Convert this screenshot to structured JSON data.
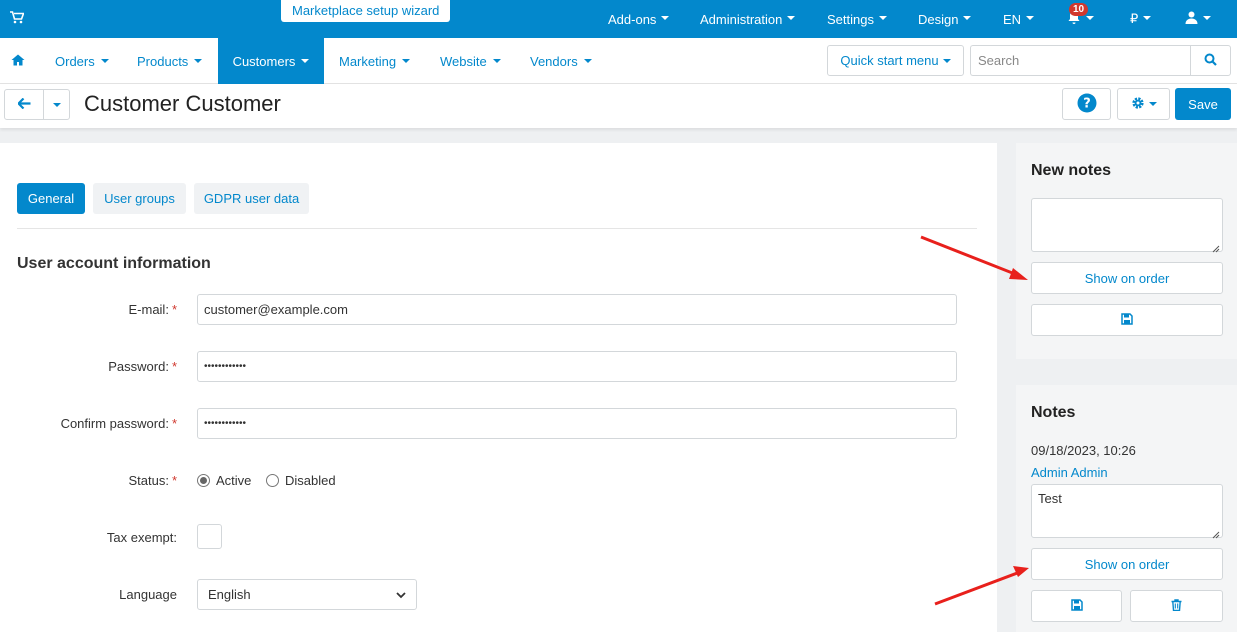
{
  "topbar": {
    "wizard_label": "Marketplace setup wizard",
    "menu": [
      {
        "label": "Add-ons"
      },
      {
        "label": "Administration"
      },
      {
        "label": "Settings"
      },
      {
        "label": "Design"
      },
      {
        "label": "EN"
      }
    ],
    "notifications_count": "10",
    "currency": "₽"
  },
  "navbar": {
    "items": [
      {
        "label": "Orders"
      },
      {
        "label": "Products"
      },
      {
        "label": "Customers"
      },
      {
        "label": "Marketing"
      },
      {
        "label": "Website"
      },
      {
        "label": "Vendors"
      }
    ],
    "quick_start_label": "Quick start menu",
    "search_placeholder": "Search"
  },
  "titlebar": {
    "title": "Customer Customer",
    "save_label": "Save"
  },
  "tabs": [
    {
      "label": "General"
    },
    {
      "label": "User groups"
    },
    {
      "label": "GDPR user data"
    }
  ],
  "form": {
    "section_title": "User account information",
    "email_label": "E-mail:",
    "email_value": "customer@example.com",
    "password_label": "Password:",
    "password_value": "••••••••••••",
    "confirm_label": "Confirm password:",
    "confirm_value": "••••••••••••",
    "status_label": "Status:",
    "status_active": "Active",
    "status_disabled": "Disabled",
    "tax_label": "Tax exempt:",
    "language_label": "Language",
    "language_value": "English",
    "required_mark": "*"
  },
  "sidebar": {
    "new_notes_title": "New notes",
    "show_on_order": "Show on order",
    "notes_title": "Notes",
    "note_date": "09/18/2023, 10:26",
    "note_author": "Admin Admin",
    "note_text": "Test"
  },
  "colors": {
    "accent": "#0388cc",
    "required": "#d0382e",
    "arrow": "#e8201c"
  }
}
